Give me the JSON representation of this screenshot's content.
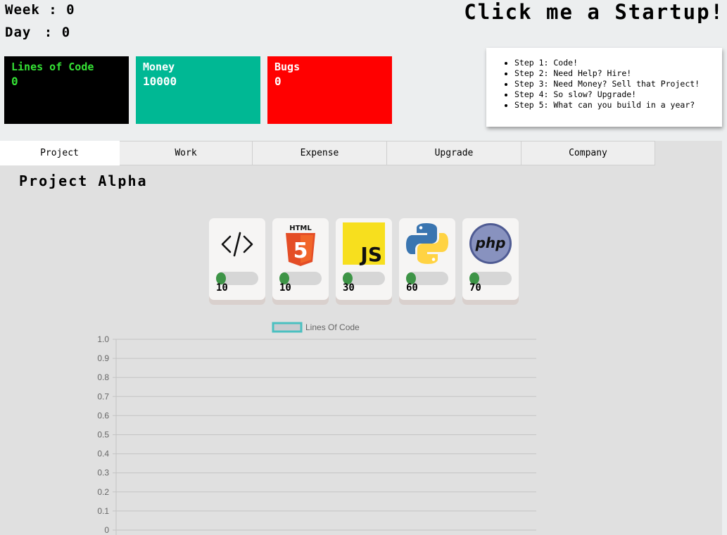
{
  "header": {
    "week_label": "Week",
    "week_value": "0",
    "day_label": "Day",
    "day_value": "0",
    "separator": ":",
    "title": "Click me a Startup!"
  },
  "stats": [
    {
      "label": "Lines of Code",
      "value": "0",
      "color": "#000000",
      "text_color": "#35e235"
    },
    {
      "label": "Money",
      "value": "10000",
      "color": "#00b894",
      "text_color": "#ffffff"
    },
    {
      "label": "Bugs",
      "value": "0",
      "color": "#ff0000",
      "text_color": "#ffffff"
    }
  ],
  "steps": [
    "Step 1: Code!",
    "Step 2: Need Help? Hire!",
    "Step 3: Need Money? Sell that Project!",
    "Step 4: So slow? Upgrade!",
    "Step 5: What can you build in a year?"
  ],
  "tabs": [
    {
      "label": "Project",
      "active": true
    },
    {
      "label": "Work",
      "active": false
    },
    {
      "label": "Expense",
      "active": false
    },
    {
      "label": "Upgrade",
      "active": false
    },
    {
      "label": "Company",
      "active": false
    }
  ],
  "project_title": "Project Alpha",
  "languages": [
    {
      "icon": "code-icon",
      "cost": "10",
      "progress": 0
    },
    {
      "icon": "html5-icon",
      "cost": "10",
      "progress": 0,
      "logo_text": "HTML",
      "logo_number": "5"
    },
    {
      "icon": "javascript-icon",
      "cost": "30",
      "progress": 0,
      "logo_text": "JS"
    },
    {
      "icon": "python-icon",
      "cost": "60",
      "progress": 0
    },
    {
      "icon": "php-icon",
      "cost": "70",
      "progress": 0,
      "logo_text": "php"
    }
  ],
  "colors": {
    "chart_line": "#4bc0c0",
    "chart_fill": "#c9cbcf",
    "progress_knob": "#3d9446"
  },
  "chart_data": {
    "type": "line",
    "series": [
      {
        "name": "Lines Of Code",
        "values": []
      }
    ],
    "yticks": [
      "1.0",
      "0.9",
      "0.8",
      "0.7",
      "0.6",
      "0.5",
      "0.4",
      "0.3",
      "0.2",
      "0.1",
      "0"
    ],
    "ylim": [
      0,
      1
    ],
    "legend": "top",
    "grid": true
  }
}
